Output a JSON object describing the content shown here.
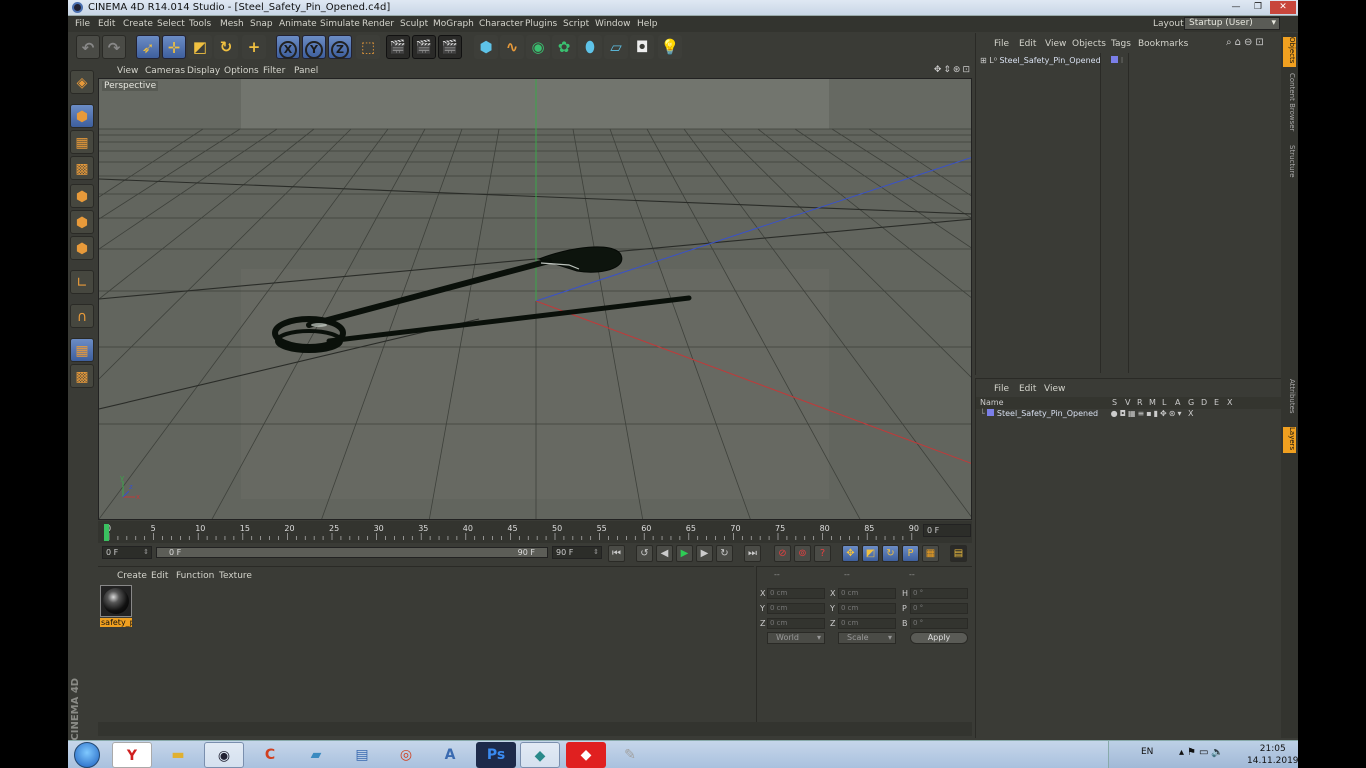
{
  "window": {
    "title": "CINEMA 4D R14.014 Studio - [Steel_Safety_Pin_Opened.c4d]"
  },
  "menu": {
    "items": [
      "File",
      "Edit",
      "Create",
      "Select",
      "Tools",
      "Mesh",
      "Snap",
      "Animate",
      "Simulate",
      "Render",
      "Sculpt",
      "MoGraph",
      "Character",
      "Plugins",
      "Script",
      "Window",
      "Help"
    ],
    "layout_label": "Layout:",
    "layout_value": "Startup (User)"
  },
  "toolbar": {
    "axis_x": "X",
    "axis_y": "Y",
    "axis_z": "Z"
  },
  "viewport": {
    "menu": [
      "View",
      "Cameras",
      "Display",
      "Options",
      "Filter",
      "Panel"
    ],
    "camera_label": "Perspective"
  },
  "timeline": {
    "ticks": [
      "0",
      "5",
      "10",
      "15",
      "20",
      "25",
      "30",
      "35",
      "40",
      "45",
      "50",
      "55",
      "60",
      "65",
      "70",
      "75",
      "80",
      "85",
      "90"
    ],
    "current_frame": "0 F",
    "start_field": "0 F",
    "range_start": "0 F",
    "range_end": "90 F",
    "end_field": "90 F"
  },
  "material_manager": {
    "menu": [
      "Create",
      "Edit",
      "Function",
      "Texture"
    ],
    "material_name": "safety_p"
  },
  "coordinates": {
    "headers": [
      "--",
      "--",
      "--"
    ],
    "rows": [
      {
        "a": "X",
        "av": "0 cm",
        "b": "X",
        "bv": "0 cm",
        "c": "H",
        "cv": "0 °"
      },
      {
        "a": "Y",
        "av": "0 cm",
        "b": "Y",
        "bv": "0 cm",
        "c": "P",
        "cv": "0 °"
      },
      {
        "a": "Z",
        "av": "0 cm",
        "b": "Z",
        "bv": "0 cm",
        "c": "B",
        "cv": "0 °"
      }
    ],
    "mode": "World",
    "scale": "Scale",
    "apply": "Apply"
  },
  "object_manager": {
    "menu": [
      "File",
      "Edit",
      "View",
      "Objects",
      "Tags",
      "Bookmarks"
    ],
    "object_name": "Steel_Safety_Pin_Opened",
    "object_color": "#7b7fe8"
  },
  "layer_manager": {
    "menu": [
      "File",
      "Edit",
      "View"
    ],
    "columns": [
      "Name",
      "S",
      "V",
      "R",
      "M",
      "L",
      "A",
      "G",
      "D",
      "E",
      "X"
    ],
    "layer_name": "Steel_Safety_Pin_Opened"
  },
  "side_tabs": [
    "Objects",
    "Content Browser",
    "Structure",
    "Attributes",
    "Layers"
  ],
  "branding": "MAXON CINEMA 4D",
  "taskbar": {
    "language": "EN",
    "time": "21:05",
    "date": "14.11.2019"
  }
}
